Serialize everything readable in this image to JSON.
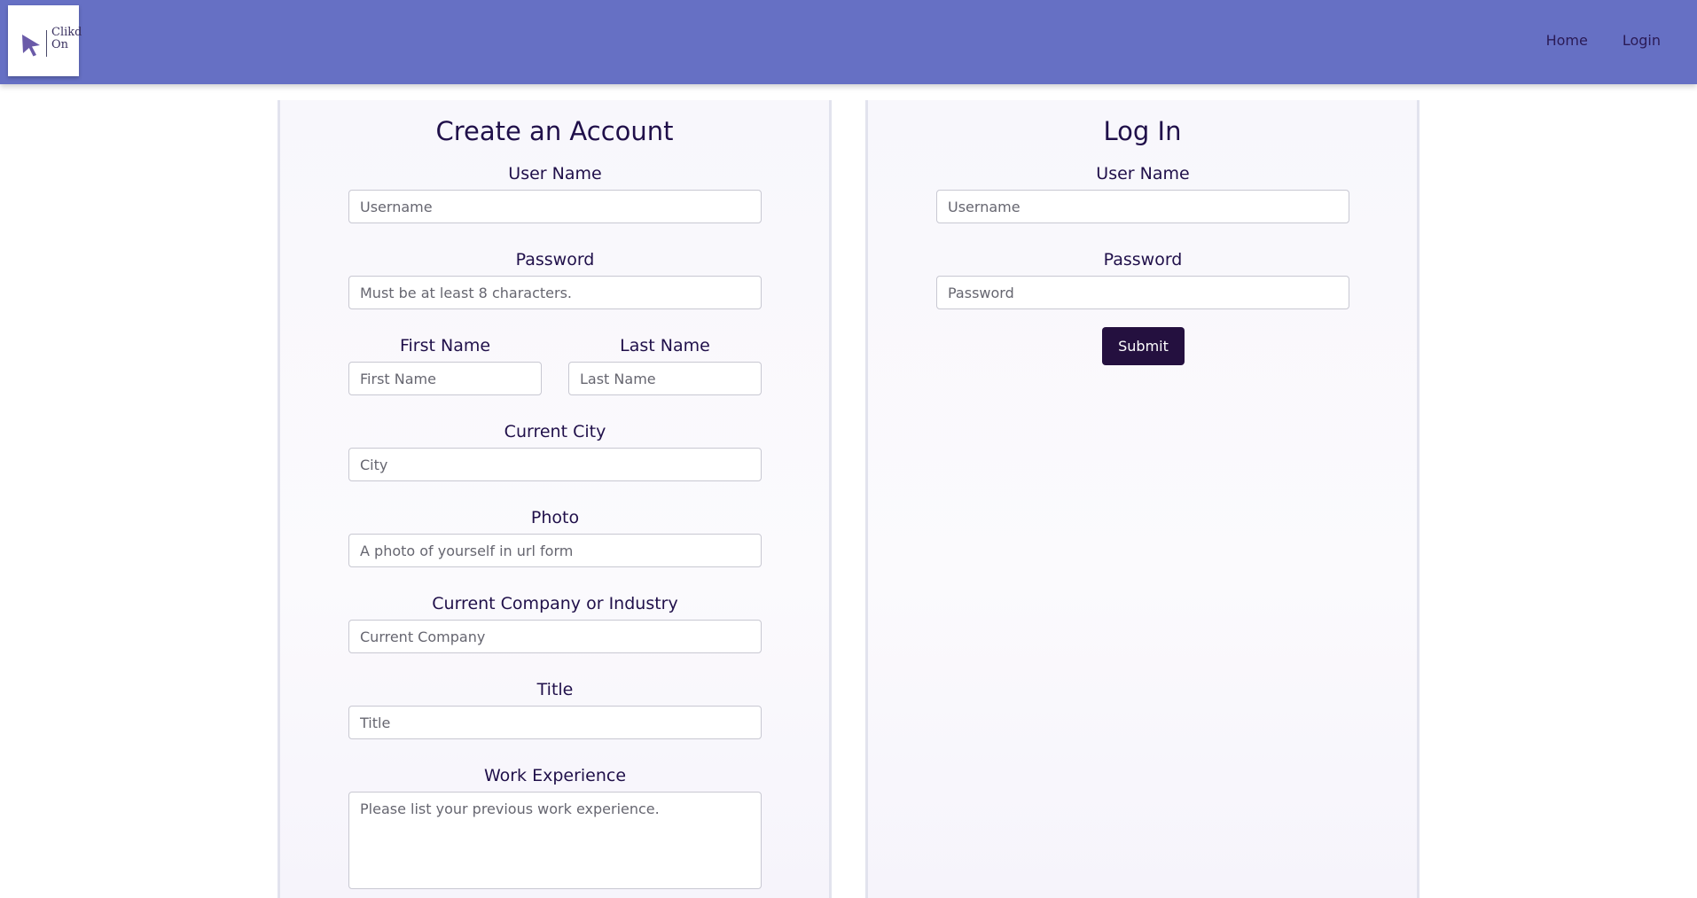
{
  "brand": {
    "logo_text_line1": "Clikd",
    "logo_text_line2": "On",
    "logo_icon": "cursor-arrow-icon",
    "accent_color": "#6670c4"
  },
  "nav": {
    "items": [
      {
        "label": "Home"
      },
      {
        "label": "Login"
      }
    ]
  },
  "signup": {
    "title": "Create an Account",
    "username": {
      "label": "User Name",
      "placeholder": "Username"
    },
    "password": {
      "label": "Password",
      "placeholder": "Must be at least 8 characters."
    },
    "first_name": {
      "label": "First Name",
      "placeholder": "First Name"
    },
    "last_name": {
      "label": "Last Name",
      "placeholder": "Last Name"
    },
    "city": {
      "label": "Current City",
      "placeholder": "City"
    },
    "photo": {
      "label": "Photo",
      "placeholder": "A photo of yourself in url form"
    },
    "company": {
      "label": "Current Company or Industry",
      "placeholder": "Current Company"
    },
    "title_field": {
      "label": "Title",
      "placeholder": "Title"
    },
    "experience": {
      "label": "Work Experience",
      "placeholder": "Please list your previous work experience."
    }
  },
  "login": {
    "title": "Log In",
    "username": {
      "label": "User Name",
      "placeholder": "Username"
    },
    "password": {
      "label": "Password",
      "placeholder": "Password"
    },
    "submit_label": "Submit",
    "submit_color": "#24103f"
  }
}
